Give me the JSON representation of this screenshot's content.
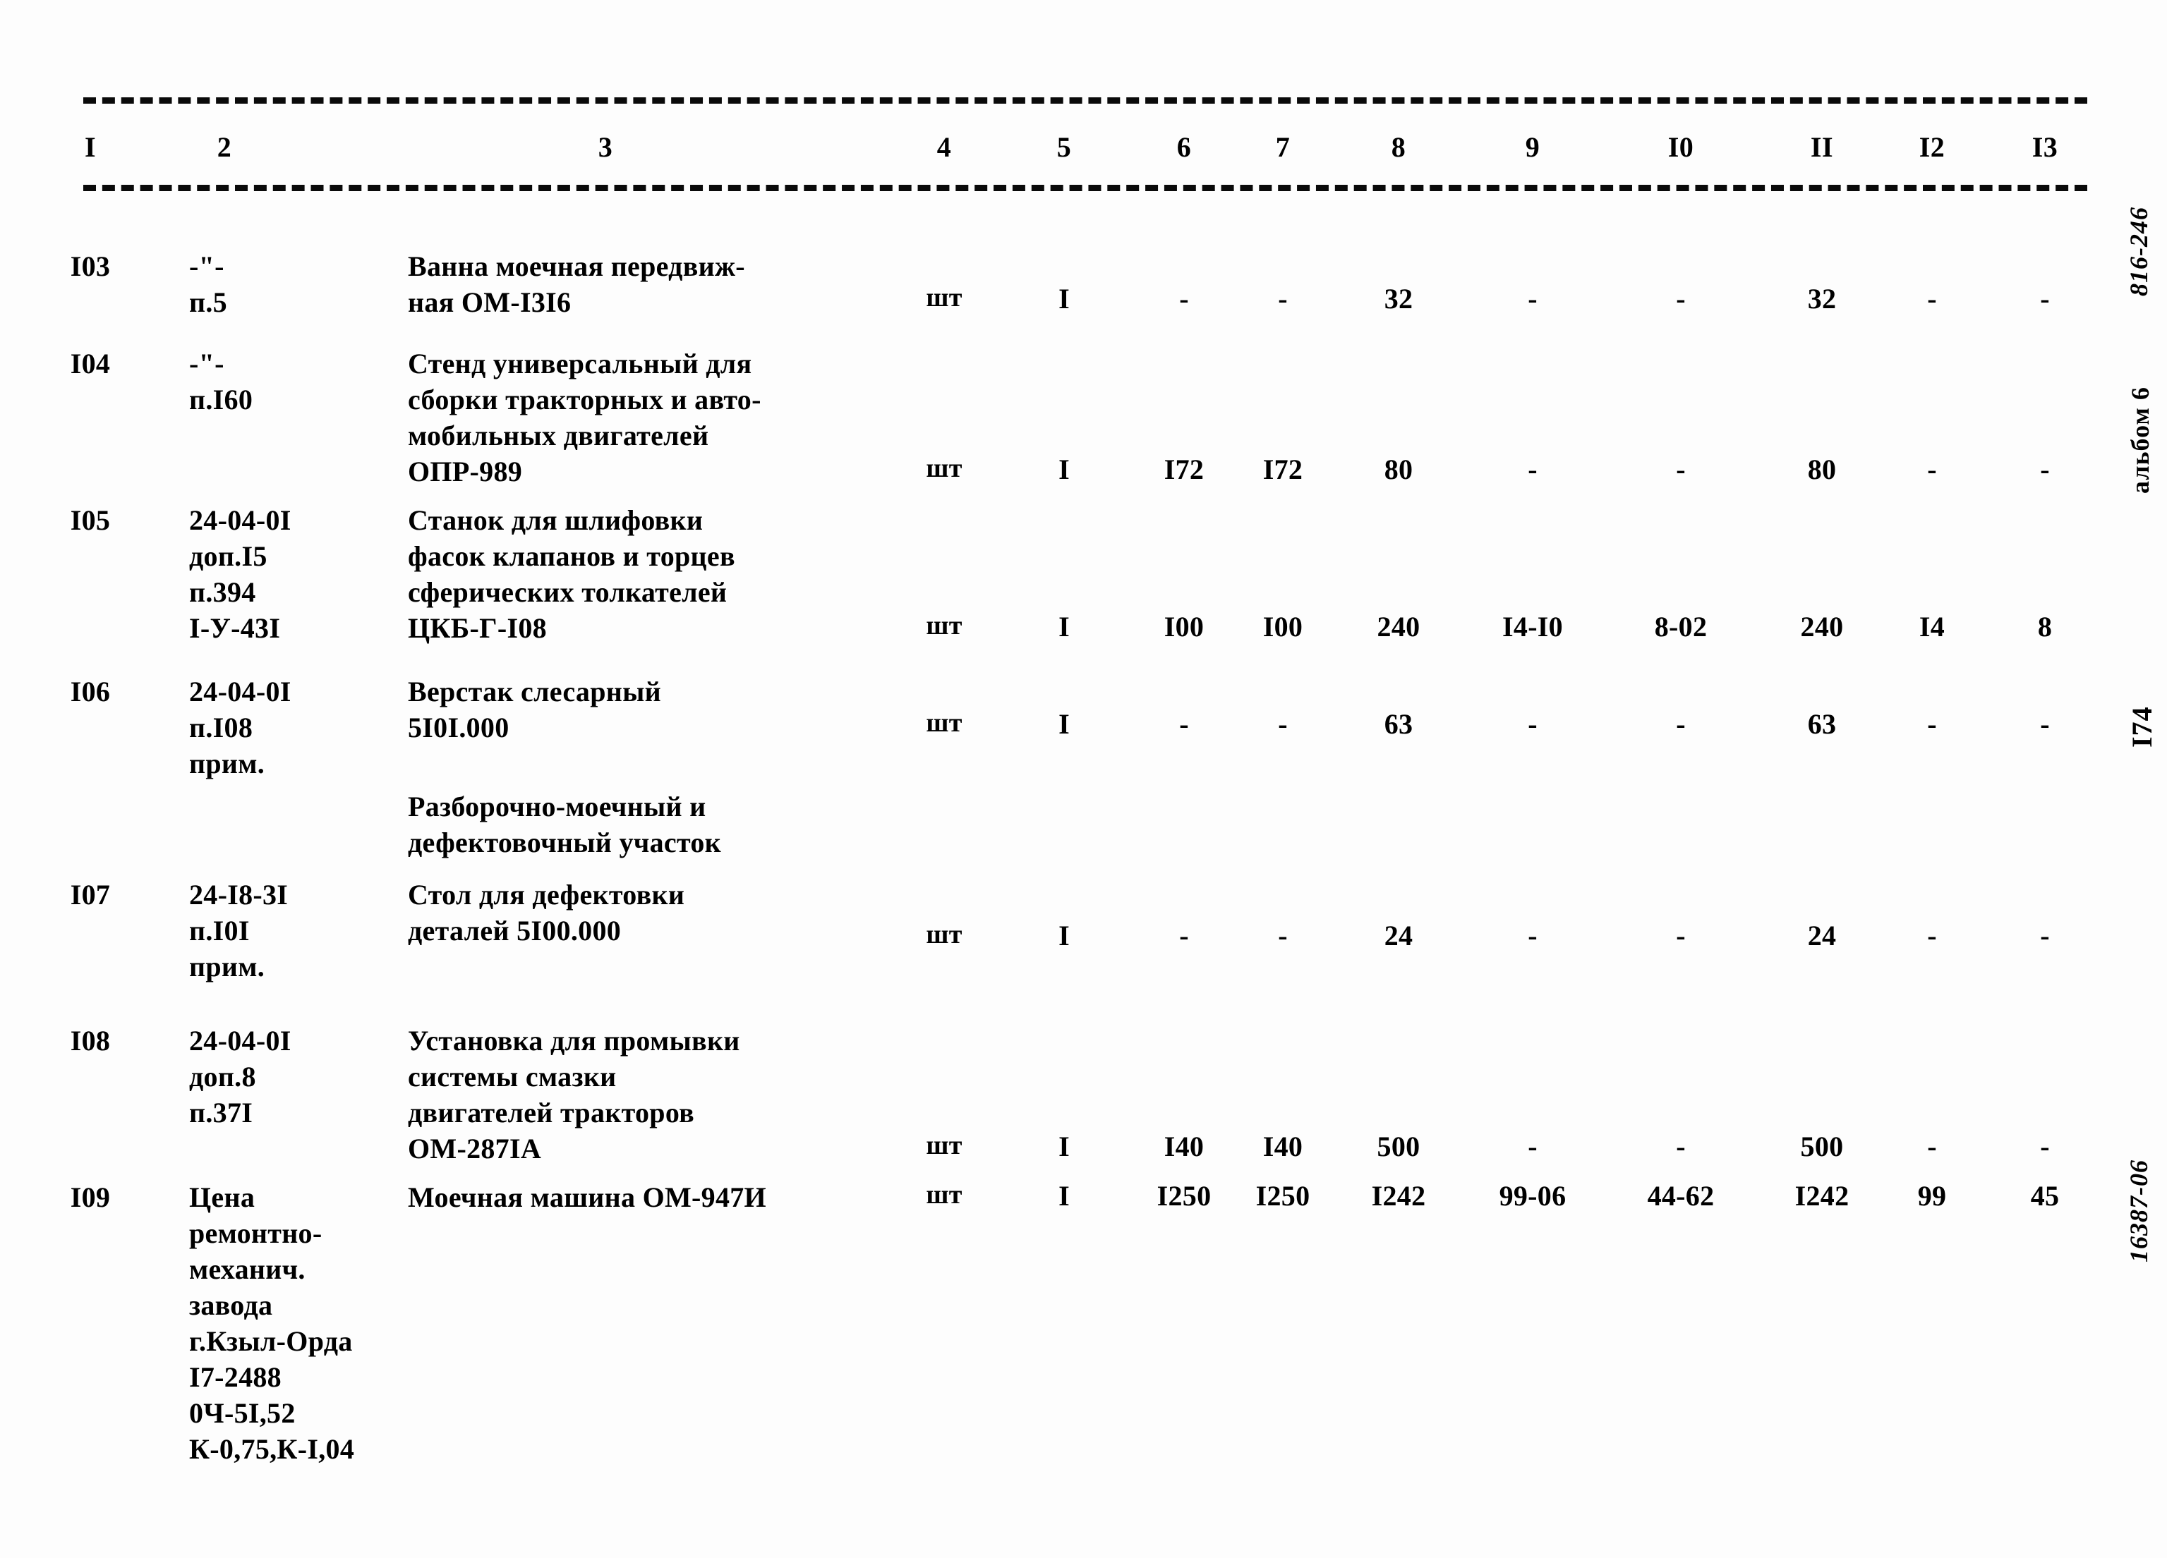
{
  "document": {
    "type": "scanned-technical-specification-table",
    "page_background": "#fdfdfd",
    "ink_color": "#0a0a0a"
  },
  "table": {
    "column_numbers": [
      "I",
      "2",
      "3",
      "4",
      "5",
      "6",
      "7",
      "8",
      "9",
      "I0",
      "II",
      "I2",
      "I3"
    ],
    "rows": [
      {
        "id": "I03",
        "code": "-\"-\nп.5",
        "name": "Ванна моечная передвиж-\nная ОМ-I3I6",
        "unit": "шт",
        "c5": "I",
        "c6": "-",
        "c7": "-",
        "c8": "32",
        "c9": "-",
        "c10": "-",
        "c11": "32",
        "c12": "-",
        "c13": "-"
      },
      {
        "id": "I04",
        "code": "-\"-\nп.I60",
        "name": "Стенд универсальный для\nсборки тракторных и авто-\nмобильных двигателей\nОПР-989",
        "unit": "шт",
        "c5": "I",
        "c6": "I72",
        "c7": "I72",
        "c8": "80",
        "c9": "-",
        "c10": "-",
        "c11": "80",
        "c12": "-",
        "c13": "-"
      },
      {
        "id": "I05",
        "code": "24-04-0I\nдоп.I5\nп.394\nI-У-43I",
        "name": "Станок для шлифовки\nфасок клапанов и торцев\nсферических толкателей\nЦКБ-Г-I08",
        "unit": "шт",
        "c5": "I",
        "c6": "I00",
        "c7": "I00",
        "c8": "240",
        "c9": "I4-I0",
        "c10": "8-02",
        "c11": "240",
        "c12": "I4",
        "c13": "8"
      },
      {
        "id": "I06",
        "code": "24-04-0I\nп.I08\nприм.",
        "name": "Верстак слесарный\n5I0I.000",
        "unit": "шт",
        "c5": "I",
        "c6": "-",
        "c7": "-",
        "c8": "63",
        "c9": "-",
        "c10": "-",
        "c11": "63",
        "c12": "-",
        "c13": "-"
      },
      {
        "id": "I07",
        "code": "24-I8-3I\nп.I0I\nприм.",
        "name": "Стол для дефектовки\nдеталей 5I00.000",
        "unit": "шт",
        "c5": "I",
        "c6": "-",
        "c7": "-",
        "c8": "24",
        "c9": "-",
        "c10": "-",
        "c11": "24",
        "c12": "-",
        "c13": "-"
      },
      {
        "id": "I08",
        "code": "24-04-0I\nдоп.8\nп.37I",
        "name": "Установка для промывки\nсистемы смазки\nдвигателей тракторов\nОМ-287IА",
        "unit": "шт",
        "c5": "I",
        "c6": "I40",
        "c7": "I40",
        "c8": "500",
        "c9": "-",
        "c10": "-",
        "c11": "500",
        "c12": "-",
        "c13": "-"
      },
      {
        "id": "I09",
        "code": "Цена\nремонтно-\nмеханич.\nзавода\nг.Кзыл-Орда\nI7-2488\n0Ч-5I,52\nК-0,75,К-I,04",
        "name": "Моечная машина ОМ-947И",
        "unit": "шт",
        "c5": "I",
        "c6": "I250",
        "c7": "I250",
        "c8": "I242",
        "c9": "99-06",
        "c10": "44-62",
        "c11": "I242",
        "c12": "99",
        "c13": "45"
      }
    ],
    "section_title": "Разборочно-моечный и\nдефектовочный участок"
  },
  "margin_notes": {
    "document_number": "816-246",
    "album": "альбом 6",
    "page_number": "I74",
    "archive_code": "16387-06"
  }
}
